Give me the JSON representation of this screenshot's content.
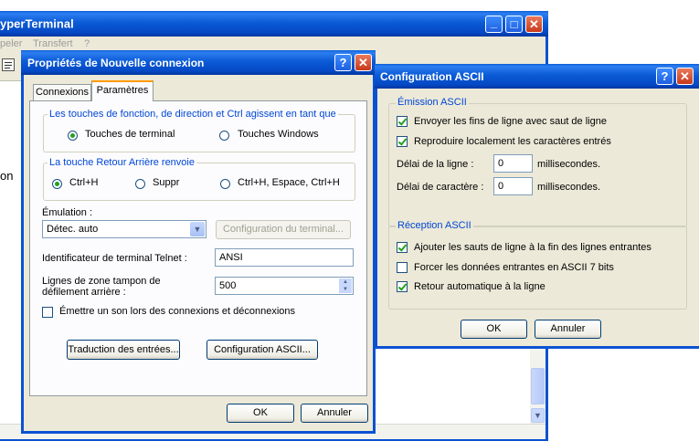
{
  "main_window": {
    "title": "yperTerminal",
    "menu": [
      "peler",
      "Transfert",
      "?"
    ],
    "side_text": "on",
    "minimize_glyph": "_",
    "maximize_glyph": "□",
    "close_glyph": "✕"
  },
  "props_dialog": {
    "title": "Propriétés de Nouvelle connexion",
    "help_glyph": "?",
    "close_glyph": "✕",
    "tabs": [
      "Connexions",
      "Paramètres"
    ],
    "fkeys_group": {
      "title": "Les touches de fonction, de direction et Ctrl agissent en tant que",
      "options": [
        "Touches de terminal",
        "Touches Windows"
      ],
      "selected": 0
    },
    "backspace_group": {
      "title": "La touche Retour Arrière renvoie",
      "options": [
        "Ctrl+H",
        "Suppr",
        "Ctrl+H, Espace, Ctrl+H"
      ],
      "selected": 0
    },
    "emulation_label": "Émulation :",
    "emulation_value": "Détec. auto",
    "terminal_config_button": "Configuration du terminal...",
    "telnet_label": "Identificateur de terminal Telnet :",
    "telnet_value": "ANSI",
    "buffer_label_1": "Lignes de zone tampon de",
    "buffer_label_2": "défilement arrière :",
    "buffer_value": "500",
    "beep_label": "Émettre un son lors des connexions et déconnexions",
    "beep_checked": false,
    "input_translation_button": "Traduction des entrées...",
    "ascii_config_button": "Configuration ASCII...",
    "ok_button": "OK",
    "cancel_button": "Annuler"
  },
  "ascii_dialog": {
    "title": "Configuration ASCII",
    "help_glyph": "?",
    "close_glyph": "✕",
    "emission": {
      "title": "Émission ASCII",
      "checks": [
        {
          "label": "Envoyer les fins de ligne avec saut de ligne",
          "checked": true
        },
        {
          "label": "Reproduire localement les caractères entrés",
          "checked": true
        }
      ],
      "line_delay_label": "Délai de la ligne :",
      "line_delay_value": "0",
      "char_delay_label": "Délai de caractère :",
      "char_delay_value": "0",
      "unit": "millisecondes."
    },
    "reception": {
      "title": "Réception ASCII",
      "checks": [
        {
          "label": "Ajouter les sauts de ligne à la fin des lignes entrantes",
          "checked": true
        },
        {
          "label": "Forcer les données entrantes en ASCII 7 bits",
          "checked": false
        },
        {
          "label": "Retour automatique à la ligne",
          "checked": true
        }
      ]
    },
    "ok_button": "OK",
    "cancel_button": "Annuler"
  },
  "colors": {
    "titlebar_blue": "#0a5fd8",
    "dialog_face": "#ece9d8",
    "group_title": "#0046d5",
    "check_green": "#21a121"
  },
  "icons": [
    "properties-icon",
    "dropdown-arrow-icon",
    "spin-up-icon",
    "spin-down-icon",
    "scroll-down-icon"
  ]
}
